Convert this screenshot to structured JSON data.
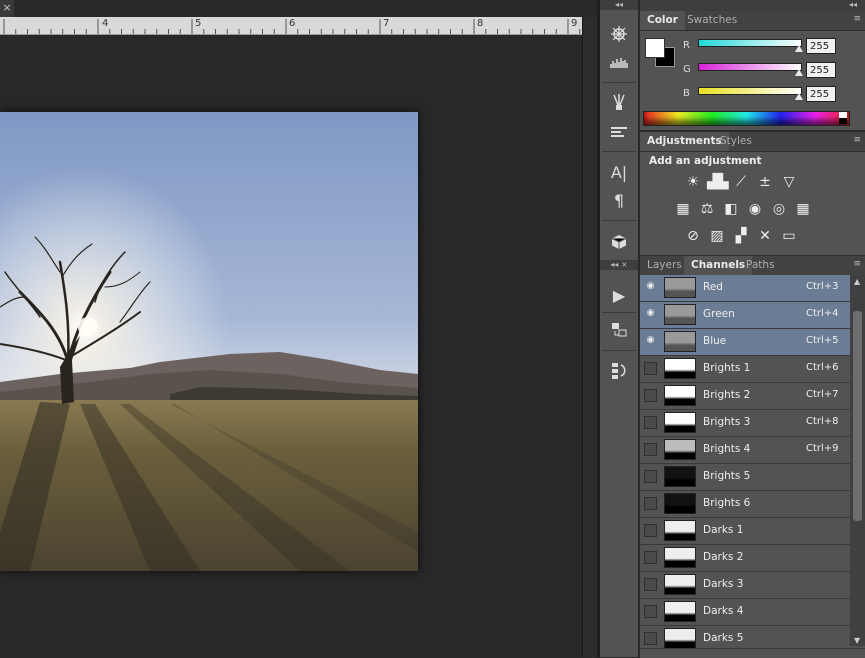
{
  "document": {
    "close_glyph": "×",
    "ruler_labels": [
      "4",
      "5",
      "6",
      "7",
      "8",
      "9"
    ]
  },
  "panel_header": {
    "collapse_glyph": "◂◂",
    "close_glyph": "×"
  },
  "toolcol": {
    "tools": [
      "compass-icon",
      "histogram-icon",
      "brushes-icon",
      "brush-presets-icon",
      "character-icon",
      "paragraph-icon",
      "3d-icon",
      "play-icon",
      "clone-source-icon",
      "history-icon"
    ],
    "glyphs": {
      "character": "A|",
      "paragraph": "¶",
      "play": "▶"
    }
  },
  "color": {
    "tabs": [
      "Color",
      "Swatches"
    ],
    "channels": [
      {
        "label": "R",
        "value": "255",
        "color": "#22d8d8"
      },
      {
        "label": "G",
        "value": "255",
        "color": "#d822d8"
      },
      {
        "label": "B",
        "value": "255",
        "color": "#e8e022"
      }
    ]
  },
  "adjustments": {
    "tabs": [
      "Adjustments",
      "Styles"
    ],
    "heading": "Add an adjustment",
    "icons": [
      [
        "brightness-contrast-icon",
        "levels-icon",
        "curves-icon",
        "exposure-icon",
        "vibrance-icon"
      ],
      [
        "hue-saturation-icon",
        "color-balance-icon",
        "black-white-icon",
        "photo-filter-icon",
        "channel-mixer-icon",
        "color-lookup-icon"
      ],
      [
        "invert-icon",
        "posterize-icon",
        "threshold-icon",
        "selective-color-icon",
        "gradient-map-icon"
      ]
    ],
    "glyphs": [
      [
        "☀",
        "▟▙",
        "⟋",
        "±",
        "▽"
      ],
      [
        "▦",
        "⚖",
        "◧",
        "◉",
        "◎",
        "▦"
      ],
      [
        "⊘",
        "▨",
        "▞",
        "✕",
        "▭"
      ]
    ]
  },
  "channels": {
    "tabs": [
      "Layers",
      "Channels",
      "Paths"
    ],
    "eye_glyph": "◉",
    "rows": [
      {
        "name": "Red",
        "shortcut": "Ctrl+3",
        "selected": true,
        "visible": true
      },
      {
        "name": "Green",
        "shortcut": "Ctrl+4",
        "selected": true,
        "visible": true
      },
      {
        "name": "Blue",
        "shortcut": "Ctrl+5",
        "selected": true,
        "visible": true
      },
      {
        "name": "Brights 1",
        "shortcut": "Ctrl+6",
        "selected": false,
        "visible": false
      },
      {
        "name": "Brights 2",
        "shortcut": "Ctrl+7",
        "selected": false,
        "visible": false
      },
      {
        "name": "Brights 3",
        "shortcut": "Ctrl+8",
        "selected": false,
        "visible": false
      },
      {
        "name": "Brights 4",
        "shortcut": "Ctrl+9",
        "selected": false,
        "visible": false
      },
      {
        "name": "Brights 5",
        "shortcut": "",
        "selected": false,
        "visible": false
      },
      {
        "name": "Brights 6",
        "shortcut": "",
        "selected": false,
        "visible": false
      },
      {
        "name": "Darks 1",
        "shortcut": "",
        "selected": false,
        "visible": false
      },
      {
        "name": "Darks 2",
        "shortcut": "",
        "selected": false,
        "visible": false
      },
      {
        "name": "Darks 3",
        "shortcut": "",
        "selected": false,
        "visible": false
      },
      {
        "name": "Darks 4",
        "shortcut": "",
        "selected": false,
        "visible": false
      },
      {
        "name": "Darks 5",
        "shortcut": "",
        "selected": false,
        "visible": false
      }
    ],
    "selection_color": "#6b7d95"
  }
}
